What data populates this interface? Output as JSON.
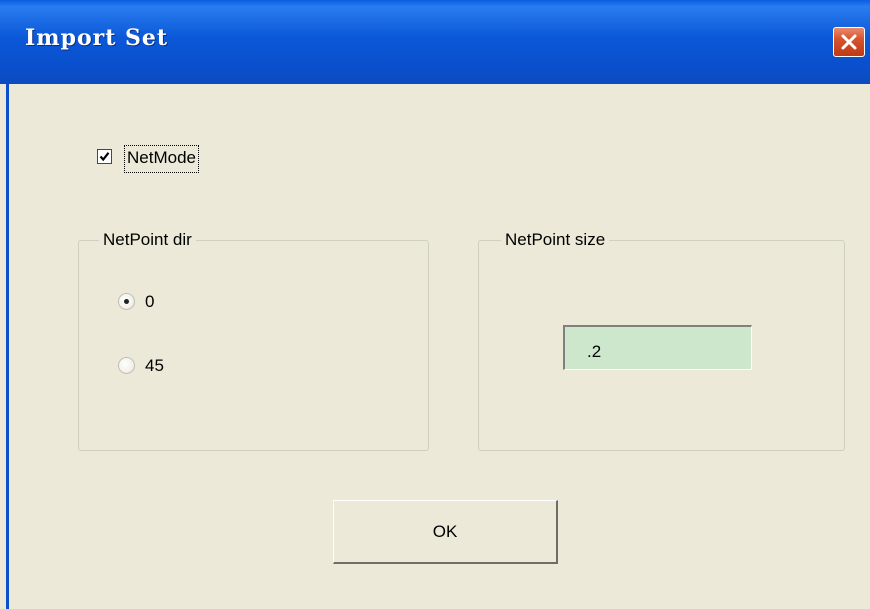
{
  "window": {
    "title": "Import Set",
    "close_icon": "close-icon"
  },
  "netmode": {
    "label": "NetMode",
    "checked": true
  },
  "netpoint_dir": {
    "legend": "NetPoint dir",
    "options": [
      {
        "label": "0",
        "selected": true
      },
      {
        "label": "45",
        "selected": false
      }
    ]
  },
  "netpoint_size": {
    "legend": "NetPoint size",
    "value": ".2"
  },
  "buttons": {
    "ok_label": "OK"
  },
  "colors": {
    "titlebar": "#0b58d8",
    "face": "#ece9d8",
    "input_bg": "#cde7cd",
    "close_button": "#d6532d"
  }
}
